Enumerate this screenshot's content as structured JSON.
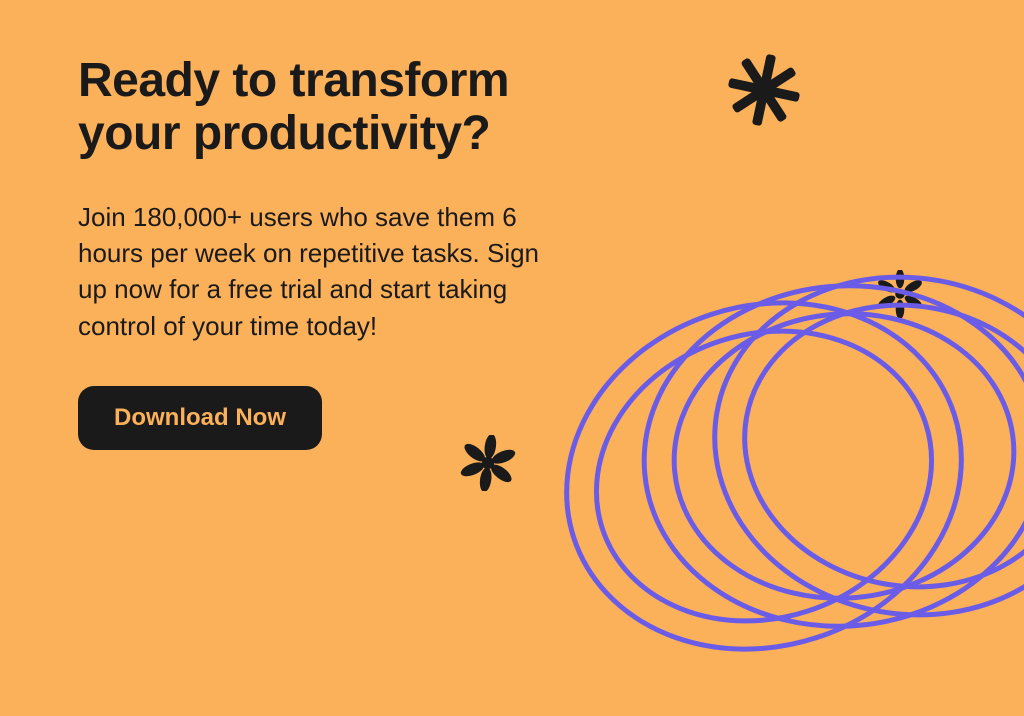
{
  "heading": "Ready to transform your productivity?",
  "body": "Join 180,000+ users who save them 6 hours per week on repetitive tasks. Sign up now for a free trial and start taking control of your time today!",
  "cta_label": "Download Now",
  "colors": {
    "background": "#fbb05a",
    "text": "#1a1a1a",
    "accent": "#6b5ce7"
  }
}
